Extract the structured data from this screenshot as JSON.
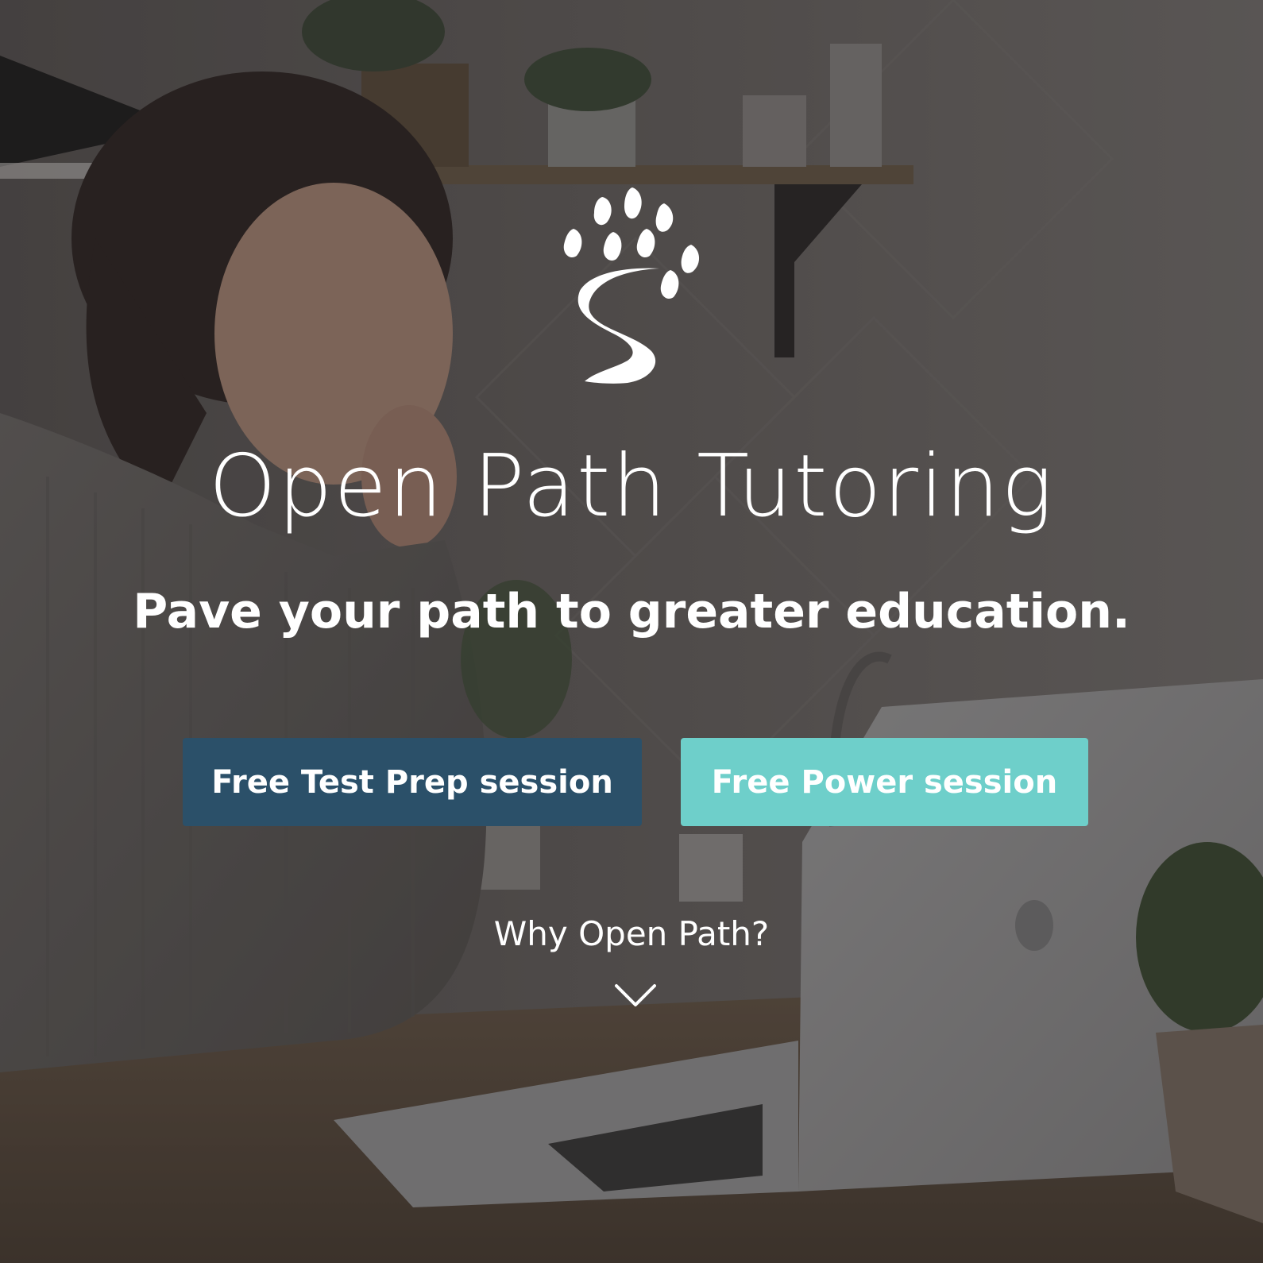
{
  "hero": {
    "title": "Open Path Tutoring",
    "tagline": "Pave your path to greater education.",
    "buttons": {
      "test_prep": "Free Test Prep session",
      "power": "Free Power session"
    },
    "why_link": "Why Open Path?"
  },
  "icons": {
    "logo": "leaf-tree-path-logo-icon",
    "scroll": "chevron-down-icon"
  },
  "colors": {
    "primary_button": "#2b5069",
    "secondary_button": "#6ecfca",
    "text": "#ffffff"
  }
}
